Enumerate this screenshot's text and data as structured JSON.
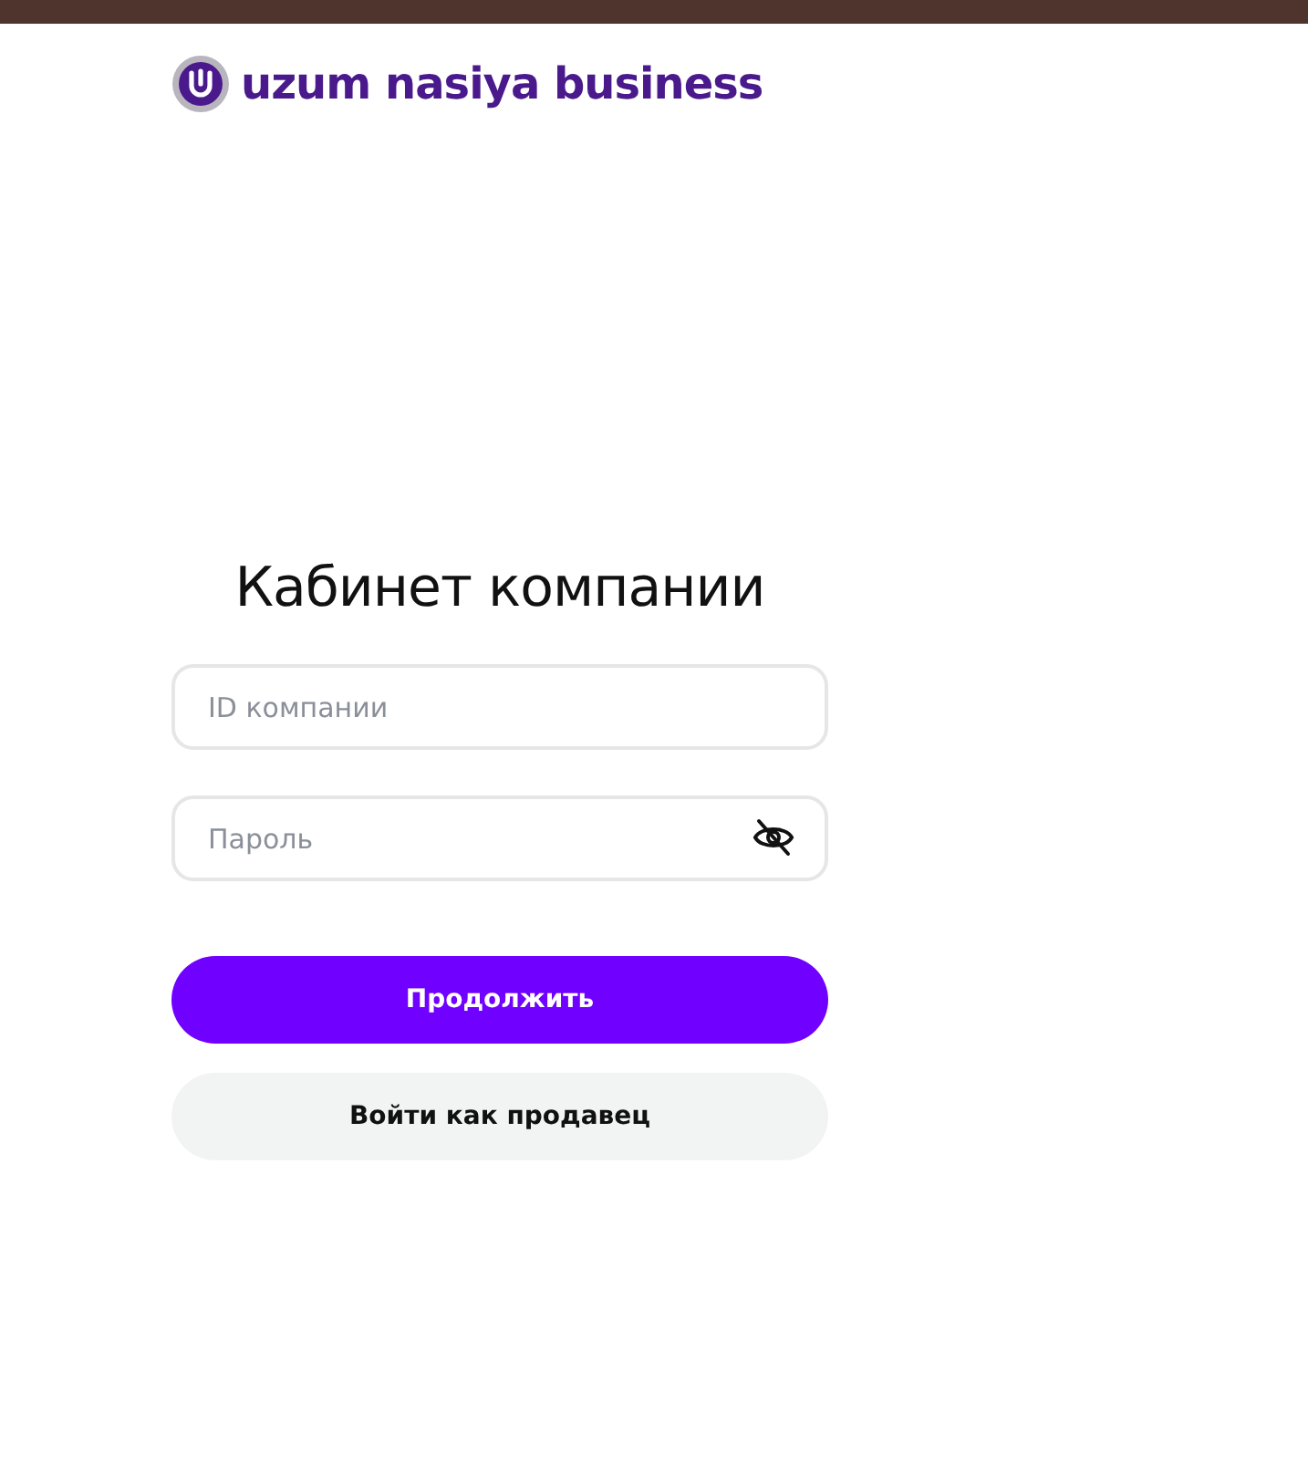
{
  "logo": {
    "text": "uzum nasiya business"
  },
  "title": "Кабинет компании",
  "fields": [
    {
      "kind": "text",
      "placeholder": "ID компании"
    },
    {
      "kind": "password",
      "placeholder": "Пароль",
      "visible": false
    }
  ],
  "buttons": [
    {
      "kind": "primary",
      "label": "Продолжить"
    },
    {
      "kind": "secondary",
      "label": "Войти как продавец"
    }
  ]
}
